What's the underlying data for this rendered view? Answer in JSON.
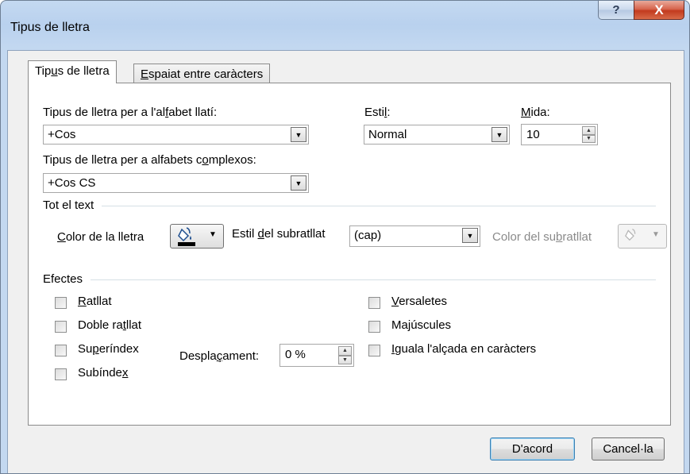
{
  "window": {
    "title": "Tipus de lletra",
    "help_label": "?",
    "close_label": "X"
  },
  "tabs": [
    {
      "pre": "Tip",
      "u": "u",
      "post": "s de lletra"
    },
    {
      "pre": "",
      "u": "E",
      "post": "spaiat entre caràcters"
    }
  ],
  "font": {
    "latin_label_pre": "Tipus de lletra per a l'al",
    "latin_label_u": "f",
    "latin_label_post": "abet llatí:",
    "latin_value": "+Cos",
    "complex_label_pre": "Tipus de lletra per a alfabets c",
    "complex_label_u": "o",
    "complex_label_post": "mplexos:",
    "complex_value": "+Cos CS",
    "style_label_pre": "Esti",
    "style_label_u": "l",
    "style_label_post": ":",
    "style_value": "Normal",
    "size_label_pre": "",
    "size_label_u": "M",
    "size_label_post": "ida:",
    "size_value": "10"
  },
  "all_text": {
    "header": "Tot el text",
    "color_label_pre": "",
    "color_label_u": "C",
    "color_label_post": "olor de la lletra",
    "underline_label_pre": "Estil ",
    "underline_label_u": "d",
    "underline_label_post": "el subratllat",
    "underline_value": "(cap)",
    "underline_color_pre": "Color del su",
    "underline_color_u": "b",
    "underline_color_post": "ratllat",
    "font_color": "#000000"
  },
  "effects": {
    "header": "Efectes",
    "left": [
      {
        "pre": "",
        "u": "R",
        "post": "atllat"
      },
      {
        "pre": "Doble ra",
        "u": "t",
        "post": "llat"
      },
      {
        "pre": "Su",
        "u": "p",
        "post": "eríndex"
      },
      {
        "pre": "Subínde",
        "u": "x",
        "post": ""
      }
    ],
    "right": [
      {
        "pre": "",
        "u": "V",
        "post": "ersaletes"
      },
      {
        "pre": "Ma",
        "u": "j",
        "post": "úscules"
      },
      {
        "pre": "",
        "u": "I",
        "post": "guala l'alçada en caràcters"
      }
    ],
    "offset_label_pre": "Despla",
    "offset_label_u": "ç",
    "offset_label_post": "ament:",
    "offset_value": "0 %"
  },
  "buttons": {
    "ok": "D'acord",
    "cancel": "Cancel·la"
  }
}
